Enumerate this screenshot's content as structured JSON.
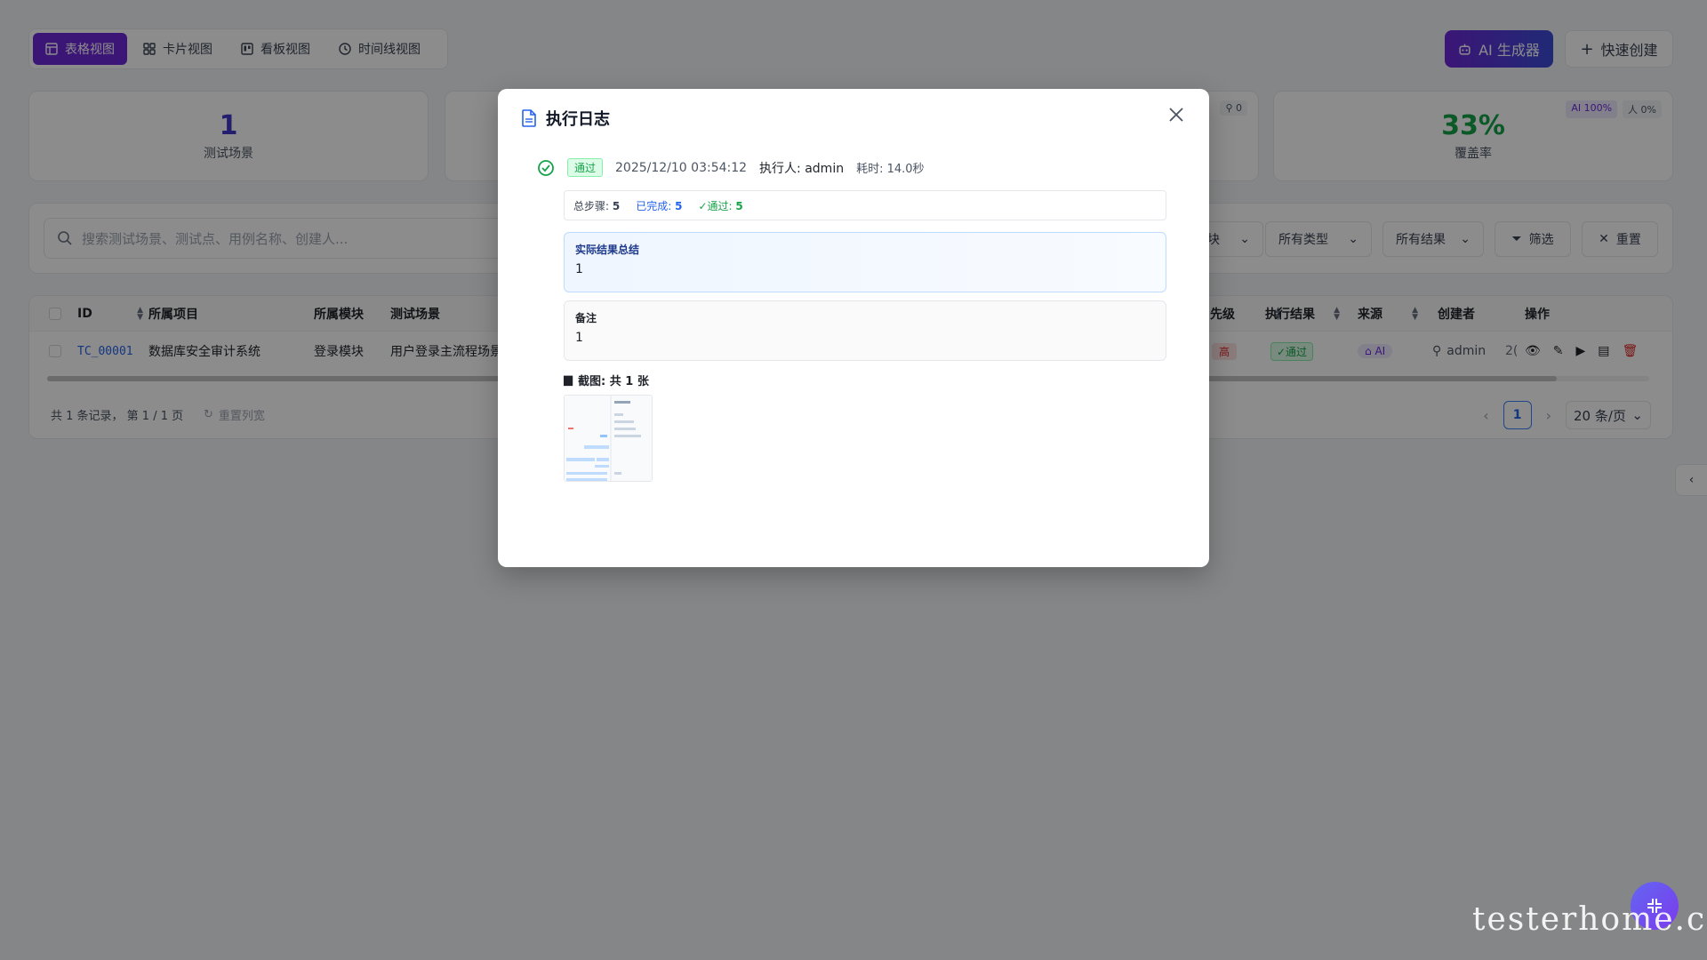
{
  "views": [
    {
      "label": "表格视图",
      "icon": "table-icon"
    },
    {
      "label": "卡片视图",
      "icon": "grid-icon"
    },
    {
      "label": "看板视图",
      "icon": "kanban-icon"
    },
    {
      "label": "时间线视图",
      "icon": "clock-icon"
    }
  ],
  "header": {
    "ai_label": "AI 生成器",
    "quick_label": "快速创建"
  },
  "stats": {
    "scene_value": "1",
    "scene_label": "测试场景",
    "person_badge": "0",
    "coverage_value": "33%",
    "coverage_label": "覆盖率",
    "ai_badge": "AI 100%",
    "human_badge": "人 0%"
  },
  "filters": {
    "search_placeholder": "搜索测试场景、测试点、用例名称、创建人...",
    "module_partial": "块",
    "type_label": "所有类型",
    "result_label": "所有结果",
    "filter_btn": "筛选",
    "reset_btn": "重置"
  },
  "table": {
    "headers": {
      "id": "ID",
      "project": "所属项目",
      "module": "所属模块",
      "scene": "测试场景",
      "priority": "先级",
      "result": "执行结果",
      "source": "来源",
      "creator": "创建者",
      "actions": "操作"
    },
    "row": {
      "id": "TC_00001",
      "project": "数据库安全审计系统",
      "module": "登录模块",
      "scene": "用户登录主流程场景",
      "priority": "高",
      "result": "✓通过",
      "source": "AI",
      "creator": "admin",
      "date_partial": "2("
    },
    "footer": {
      "summary": "共 1 条记录， 第 1 / 1 页",
      "reset_cols": "重置列宽",
      "page": "1",
      "page_size": "20 条/页"
    }
  },
  "modal": {
    "title": "执行日志",
    "status": "通过",
    "time": "2025/12/10 03:54:12",
    "executor": "执行人: admin",
    "duration": "耗时: 14.0秒",
    "steps": {
      "total_label": "总步骤:",
      "total": "5",
      "done_label": "已完成:",
      "done": "5",
      "pass_label": "✓通过:",
      "pass": "5"
    },
    "result_title": "实际结果总结",
    "result_value": "1",
    "note_title": "备注",
    "note_value": "1",
    "screenshots_label": "截图: 共 1 张"
  },
  "watermark": "testerhome.com",
  "colors": {
    "brand": "#6d28d9",
    "accent": "#2563eb",
    "success": "#16a34a",
    "danger": "#dc2626"
  }
}
